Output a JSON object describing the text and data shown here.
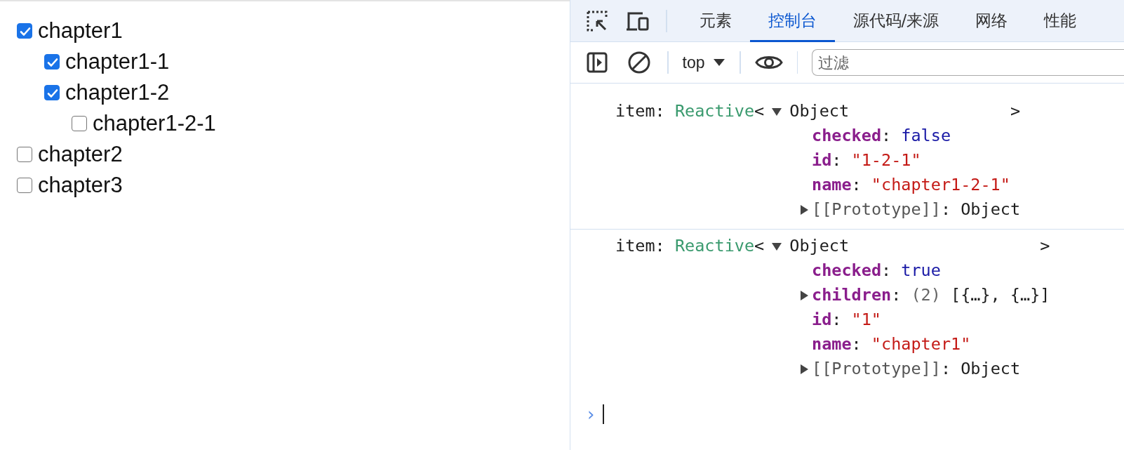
{
  "tree": [
    {
      "name": "chapter1",
      "checked": true,
      "children": [
        {
          "name": "chapter1-1",
          "checked": true
        },
        {
          "name": "chapter1-2",
          "checked": true,
          "children": [
            {
              "name": "chapter1-2-1",
              "checked": false
            }
          ]
        }
      ]
    },
    {
      "name": "chapter2",
      "checked": false
    },
    {
      "name": "chapter3",
      "checked": false
    }
  ],
  "devtools": {
    "tabs": [
      {
        "label": "元素",
        "selected": false
      },
      {
        "label": "控制台",
        "selected": true
      },
      {
        "label": "源代码/来源",
        "selected": false
      },
      {
        "label": "网络",
        "selected": false
      },
      {
        "label": "性能",
        "selected": false
      }
    ],
    "context": "top",
    "filter": {
      "placeholder": "过滤"
    },
    "console": [
      {
        "label": "item:",
        "type": "Reactive",
        "open": "<",
        "expanded": true,
        "summary": "Object",
        "close": ">",
        "props": [
          {
            "key": "checked",
            "colon": ":",
            "kind": "bool",
            "value": "false",
            "expandable": false
          },
          {
            "key": "id",
            "colon": ":",
            "kind": "string",
            "value": "\"1-2-1\"",
            "expandable": false
          },
          {
            "key": "name",
            "colon": ":",
            "kind": "string",
            "value": "\"chapter1-2-1\"",
            "expandable": false
          },
          {
            "key": "[[Prototype]]",
            "colon": ":",
            "kind": "proto",
            "value": "Object",
            "expandable": true
          }
        ]
      },
      {
        "label": "item:",
        "type": "Reactive",
        "open": "<",
        "expanded": true,
        "summary": "Object",
        "close": ">",
        "props": [
          {
            "key": "checked",
            "colon": ":",
            "kind": "bool",
            "value": "true",
            "expandable": false
          },
          {
            "key": "children",
            "colon": ":",
            "kind": "array",
            "count": "(2)",
            "value": "[{…}, {…}]",
            "expandable": true
          },
          {
            "key": "id",
            "colon": ":",
            "kind": "string",
            "value": "\"1\"",
            "expandable": false
          },
          {
            "key": "name",
            "colon": ":",
            "kind": "string",
            "value": "\"chapter1\"",
            "expandable": false
          },
          {
            "key": "[[Prototype]]",
            "colon": ":",
            "kind": "proto",
            "value": "Object",
            "expandable": true
          }
        ]
      }
    ],
    "prompt": "›"
  }
}
